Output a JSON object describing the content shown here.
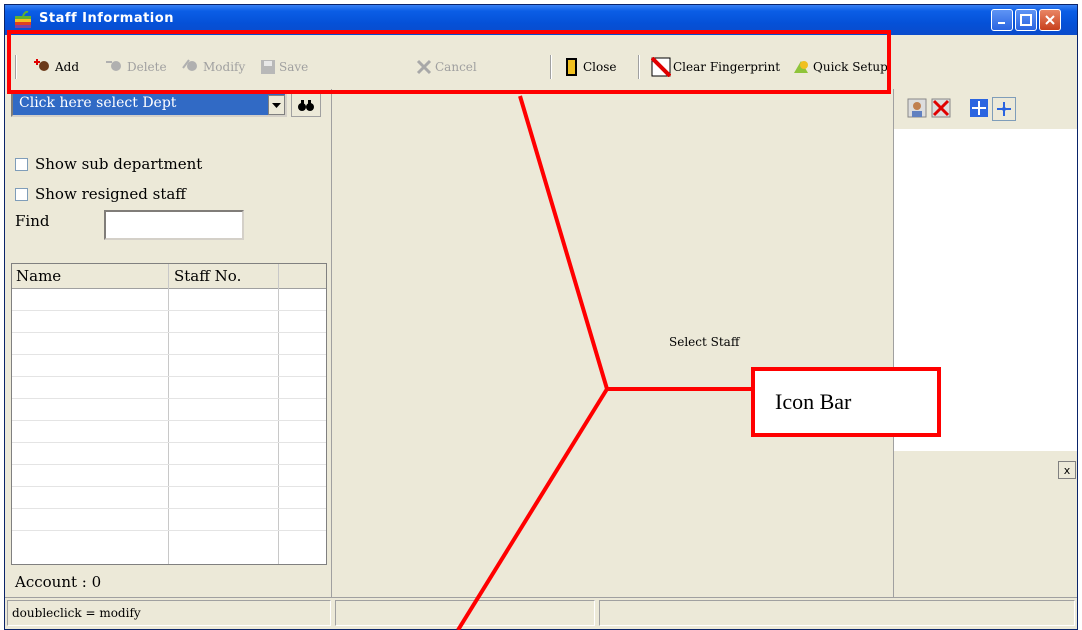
{
  "window": {
    "title": "Staff Information"
  },
  "toolbar": {
    "add": "Add",
    "delete": "Delete",
    "modify": "Modify",
    "save": "Save",
    "cancel": "Cancel",
    "close": "Close",
    "clear_fingerprint": "Clear Fingerprint",
    "quick_setup": "Quick Setup"
  },
  "left_panel": {
    "dept_select": "Click here select Dept",
    "show_sub_department": "Show sub department",
    "show_resigned_staff": "Show resigned staff",
    "find_label": "Find",
    "find_value": "",
    "columns": [
      "Name",
      "Staff No."
    ],
    "account": "Account : 0"
  },
  "center": {
    "placeholder": "Select Staff"
  },
  "statusbar": {
    "hint": "doubleclick = modify"
  },
  "annotation": {
    "callout": "Icon Bar"
  },
  "colors": {
    "titlebar": "#0551d8",
    "highlight": "#316ac5",
    "annotation": "#ff0000",
    "panel": "#ece9d8"
  }
}
